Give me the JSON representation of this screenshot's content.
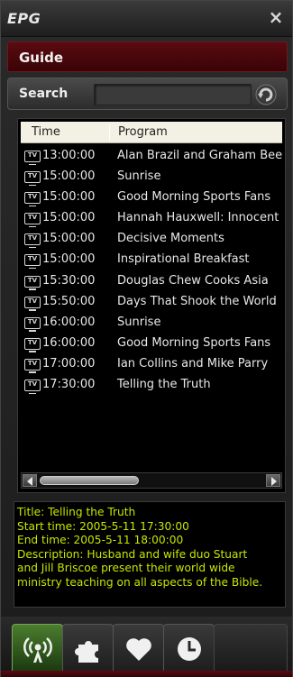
{
  "window": {
    "title": "EPG",
    "close_symbol": "×"
  },
  "guide": {
    "label": "Guide"
  },
  "search": {
    "label": "Search",
    "value": "",
    "placeholder": ""
  },
  "table": {
    "columns": [
      "Time",
      "Program"
    ],
    "rows": [
      {
        "time": "13:00:00",
        "program": "Alan Brazil and Graham Bee"
      },
      {
        "time": "15:00:00",
        "program": "Sunrise"
      },
      {
        "time": "15:00:00",
        "program": "Good Morning Sports Fans"
      },
      {
        "time": "15:00:00",
        "program": "Hannah Hauxwell: Innocent"
      },
      {
        "time": "15:00:00",
        "program": "Decisive Moments"
      },
      {
        "time": "15:00:00",
        "program": "Inspirational Breakfast"
      },
      {
        "time": "15:30:00",
        "program": "Douglas Chew Cooks Asia"
      },
      {
        "time": "15:50:00",
        "program": "Days That Shook the World"
      },
      {
        "time": "16:00:00",
        "program": "Sunrise"
      },
      {
        "time": "16:00:00",
        "program": "Good Morning Sports Fans"
      },
      {
        "time": "17:00:00",
        "program": "Ian Collins and Mike Parry"
      },
      {
        "time": "17:30:00",
        "program": "Telling the Truth"
      }
    ],
    "row_icon": "tv-icon",
    "row_icon_text": "TV"
  },
  "detail": {
    "lines": [
      "Title: Telling the Truth",
      "Start time: 2005-5-11 17:30:00",
      "End time: 2005-5-11 18:00:00",
      "Description: Husband and wife duo Stuart",
      "and Jill Briscoe present their world wide",
      "ministry teaching on all aspects of the Bible."
    ]
  },
  "tabs": [
    {
      "name": "broadcast",
      "icon": "broadcast-icon",
      "active": true
    },
    {
      "name": "plugins",
      "icon": "puzzle-icon",
      "active": false
    },
    {
      "name": "favorites",
      "icon": "heart-icon",
      "active": false
    },
    {
      "name": "schedule",
      "icon": "clock-icon",
      "active": false
    }
  ],
  "colors": {
    "accent_red": "#5a0b10",
    "detail_text": "#c8e600",
    "active_tab": "#4b7d2e"
  }
}
